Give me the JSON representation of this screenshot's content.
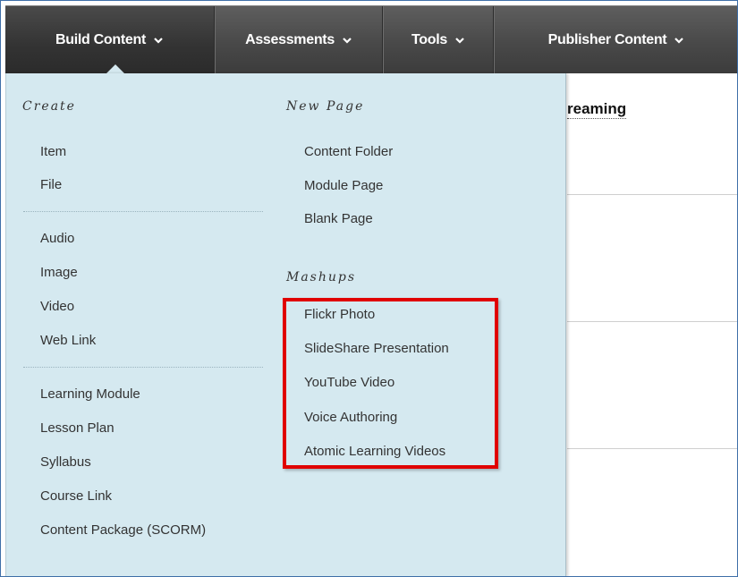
{
  "toolbar": {
    "tabs": [
      {
        "label": "Build Content",
        "icon": "chevron-down-icon"
      },
      {
        "label": "Assessments",
        "icon": "chevron-down-icon"
      },
      {
        "label": "Tools",
        "icon": "chevron-down-icon"
      },
      {
        "label": "Publisher Content",
        "icon": "chevron-down-icon"
      }
    ]
  },
  "background": {
    "heading": "reaming"
  },
  "menu": {
    "create": {
      "title": "Create",
      "items": [
        "Item",
        "File",
        "Audio",
        "Image",
        "Video",
        "Web Link",
        "Learning Module",
        "Lesson Plan",
        "Syllabus",
        "Course Link",
        "Content Package (SCORM)"
      ]
    },
    "new_page": {
      "title": "New Page",
      "items": [
        "Content Folder",
        "Module Page",
        "Blank Page"
      ]
    },
    "mashups": {
      "title": "Mashups",
      "items": [
        "Flickr Photo",
        "SlideShare Presentation",
        "YouTube Video",
        "Voice Authoring",
        "Atomic Learning Videos"
      ]
    }
  },
  "colors": {
    "toolbar": "#494949",
    "menu_background": "#d5e9f0",
    "highlight_border": "#e00000"
  }
}
